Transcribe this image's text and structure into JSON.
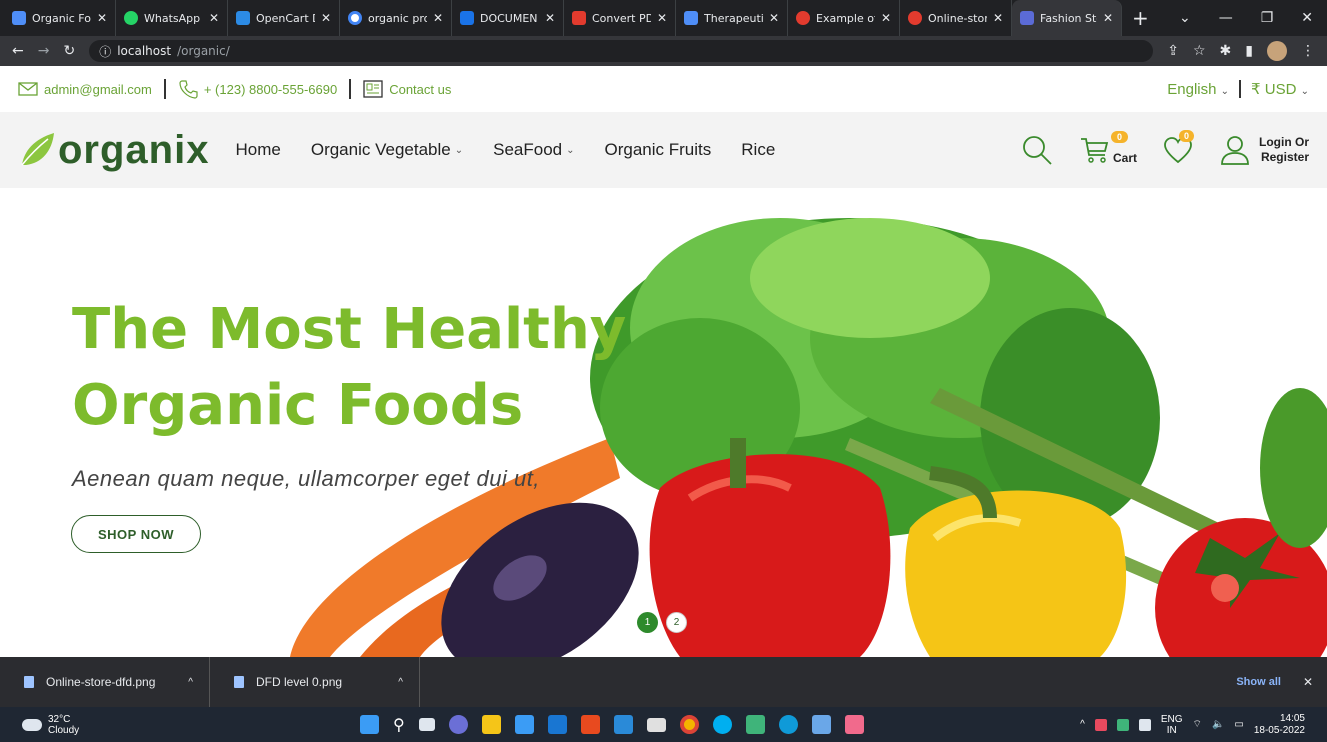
{
  "browser": {
    "tabs": [
      {
        "title": "Organic Foo",
        "color": "#4f8ef7"
      },
      {
        "title": "WhatsApp",
        "color": "#25d366"
      },
      {
        "title": "OpenCart D",
        "color": "#2c8be5"
      },
      {
        "title": "organic pro",
        "color": "#ffffff"
      },
      {
        "title": "DOCUMEN",
        "color": "#1a73e8"
      },
      {
        "title": "Convert PD",
        "color": "#e23b2e"
      },
      {
        "title": "Therapeutic",
        "color": "#4f8ef7"
      },
      {
        "title": "Example of",
        "color": "#e23b2e"
      },
      {
        "title": "Online-stor",
        "color": "#e23b2e"
      },
      {
        "title": "Fashion Sto",
        "color": "#5b6bd6"
      }
    ],
    "url_host": "localhost",
    "url_path": "/organic/"
  },
  "topstrip": {
    "email": "admin@gmail.com",
    "phone": "+ (123) 8800-555-6690",
    "contact": "Contact us",
    "language": "English",
    "currency": "₹ USD"
  },
  "header": {
    "logo": "organix",
    "nav": {
      "home": "Home",
      "vegetable": "Organic Vegetable",
      "seafood": "SeaFood",
      "fruits": "Organic Fruits",
      "rice": "Rice"
    },
    "cart_count": "0",
    "cart_label": "Cart",
    "wishlist_count": "0",
    "login_line1": "Login Or",
    "login_line2": "Register"
  },
  "hero": {
    "title_line1": "The Most Healthy",
    "title_line2": "Organic Foods",
    "subtitle": "Aenean quam neque, ullamcorper eget dui ut,",
    "button": "SHOP NOW",
    "dot1": "1",
    "dot2": "2"
  },
  "downloads": {
    "file1": "Online-store-dfd.png",
    "file2": "DFD level 0.png",
    "show_all": "Show all"
  },
  "taskbar": {
    "temp": "32°C",
    "weather": "Cloudy",
    "lang1": "ENG",
    "lang2": "IN",
    "time": "14:05",
    "date": "18-05-2022"
  },
  "colors": {
    "brand_green": "#7dbb2c",
    "dark_green": "#2e5e2a",
    "badge_orange": "#f5b32b"
  }
}
